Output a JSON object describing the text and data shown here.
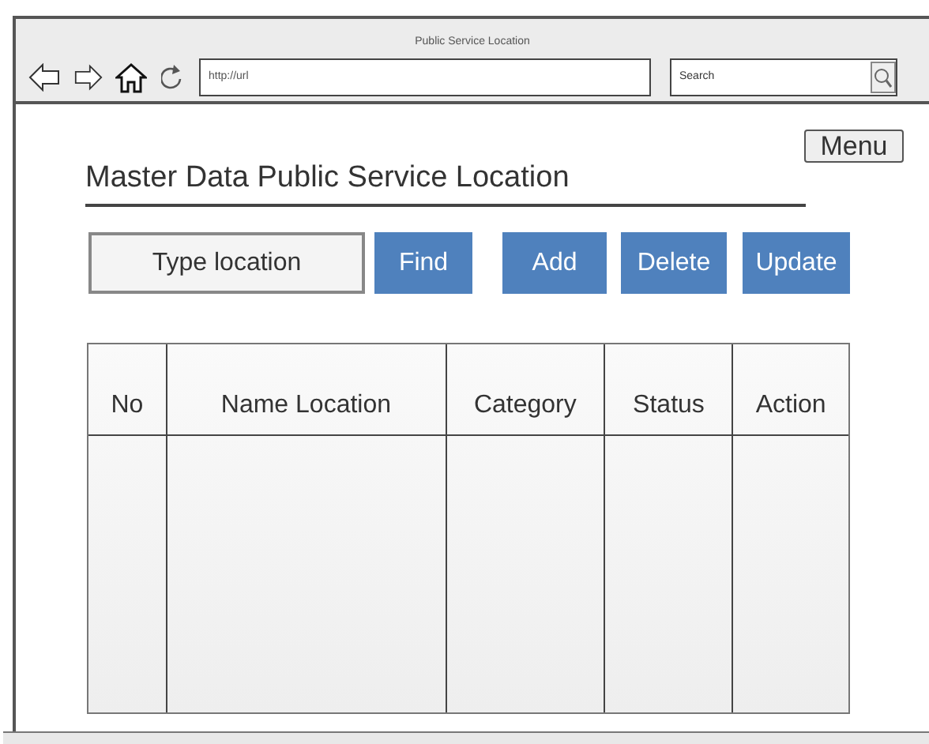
{
  "window": {
    "title": "Public Service Location"
  },
  "browser": {
    "url": "http://url",
    "search_placeholder": "Search"
  },
  "menu_button": "Menu",
  "page_title": "Master Data Public Service Location",
  "location_field": {
    "placeholder": "Type location"
  },
  "buttons": [
    "Find",
    "Add",
    "Delete",
    "Update"
  ],
  "table": {
    "columns": [
      "No",
      "Name Location",
      "Category",
      "Status",
      "Action"
    ]
  }
}
